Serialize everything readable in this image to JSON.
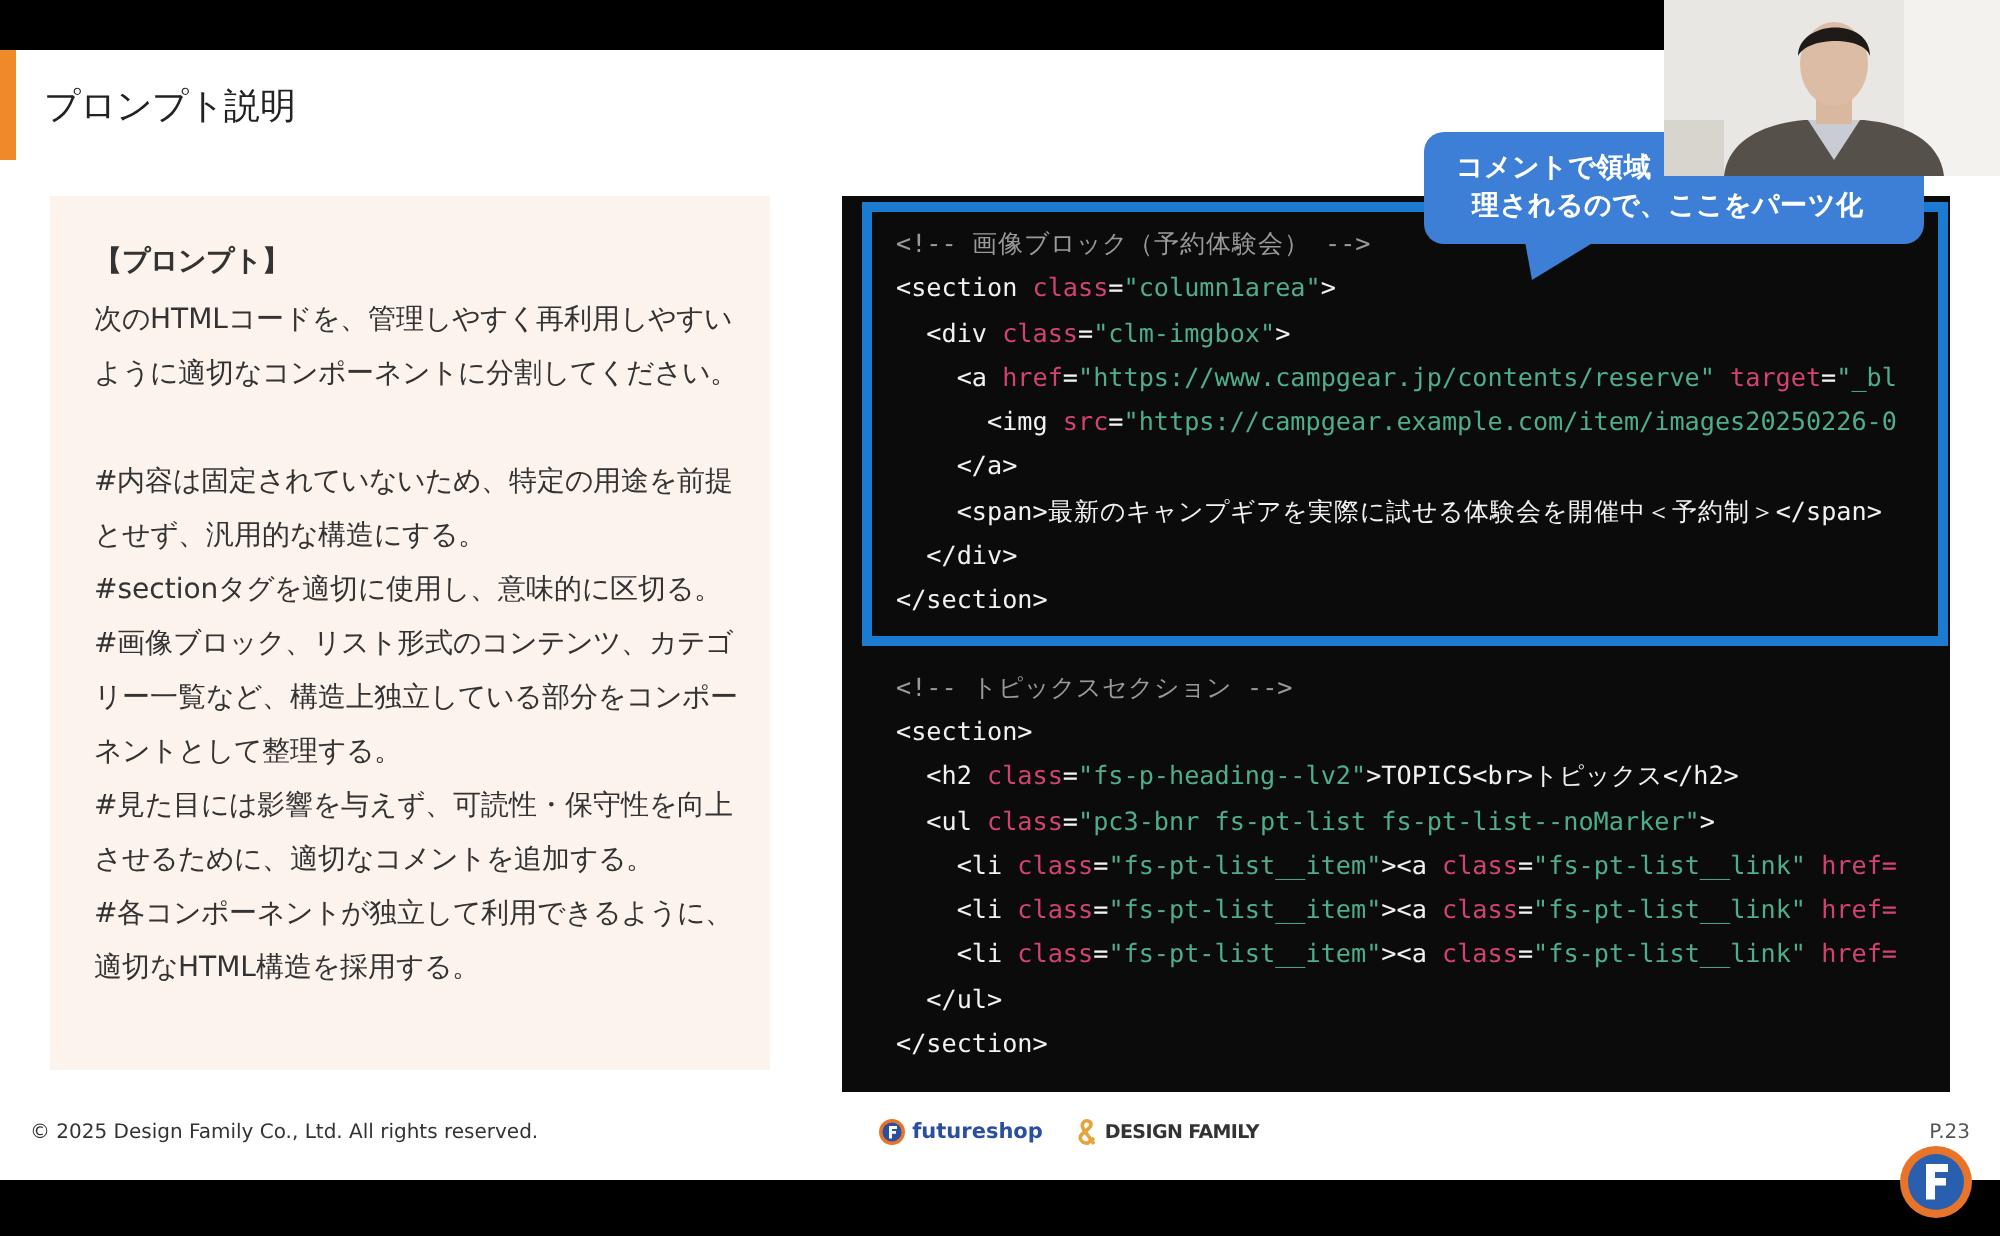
{
  "slide": {
    "title": "プロンプト説明",
    "prompt_box": {
      "heading": "【プロンプト】",
      "sections": [
        [
          "次のHTMLコードを、管理しやすく再利用しやすいように適切なコンポーネントに分割してください。"
        ],
        [
          "#内容は固定されていないため、特定の用途を前提とせず、汎用的な構造にする。",
          "#sectionタグを適切に使用し、意味的に区切る。",
          "#画像ブロック、リスト形式のコンテンツ、カテゴリー一覧など、構造上独立している部分をコンポーネントとして整理する。",
          "#見た目には影響を与えず、可読性・保守性を向上させるために、適切なコメントを追加する。",
          "#各コンポーネントが独立して利用できるように、適切なHTML構造を採用する。"
        ]
      ]
    },
    "code_blocks": [
      {
        "highlighted": true,
        "lines": [
          [
            {
              "kind": "comment",
              "text": "<!-- 画像ブロック（予約体験会） -->"
            }
          ],
          [
            {
              "kind": "tag",
              "text": "<section "
            },
            {
              "kind": "attr",
              "text": "class"
            },
            {
              "kind": "tag",
              "text": "="
            },
            {
              "kind": "str",
              "text": "\"column1area\""
            },
            {
              "kind": "tag",
              "text": ">"
            }
          ],
          [
            {
              "kind": "tag",
              "text": "  <div "
            },
            {
              "kind": "attr",
              "text": "class"
            },
            {
              "kind": "tag",
              "text": "="
            },
            {
              "kind": "str",
              "text": "\"clm-imgbox\""
            },
            {
              "kind": "tag",
              "text": ">"
            }
          ],
          [
            {
              "kind": "tag",
              "text": "    <a "
            },
            {
              "kind": "attr",
              "text": "href"
            },
            {
              "kind": "tag",
              "text": "="
            },
            {
              "kind": "str",
              "text": "\"https://www.campgear.jp/contents/reserve\""
            },
            {
              "kind": "attr",
              "text": " target"
            },
            {
              "kind": "tag",
              "text": "="
            },
            {
              "kind": "str",
              "text": "\"_bl"
            }
          ],
          [
            {
              "kind": "tag",
              "text": "      <img "
            },
            {
              "kind": "attr",
              "text": "src"
            },
            {
              "kind": "tag",
              "text": "="
            },
            {
              "kind": "str",
              "text": "\"https://campgear.example.com/item/images20250226-0"
            }
          ],
          [
            {
              "kind": "tag",
              "text": "    </a>"
            }
          ],
          [
            {
              "kind": "tag",
              "text": "    <span>最新のキャンプギアを実際に試せる体験会を開催中＜予約制＞</span>"
            }
          ],
          [
            {
              "kind": "tag",
              "text": "  </div>"
            }
          ],
          [
            {
              "kind": "tag",
              "text": "</section>"
            }
          ]
        ]
      },
      {
        "highlighted": false,
        "lines": [
          [
            {
              "kind": "comment",
              "text": "<!-- トピックスセクション -->"
            }
          ],
          [
            {
              "kind": "tag",
              "text": "<section>"
            }
          ],
          [
            {
              "kind": "tag",
              "text": "  <h2 "
            },
            {
              "kind": "attr",
              "text": "class"
            },
            {
              "kind": "tag",
              "text": "="
            },
            {
              "kind": "str",
              "text": "\"fs-p-heading--lv2\""
            },
            {
              "kind": "tag",
              "text": ">TOPICS<br>トピックス</h2>"
            }
          ],
          [
            {
              "kind": "tag",
              "text": "  <ul "
            },
            {
              "kind": "attr",
              "text": "class"
            },
            {
              "kind": "tag",
              "text": "="
            },
            {
              "kind": "str",
              "text": "\"pc3-bnr fs-pt-list fs-pt-list--noMarker\""
            },
            {
              "kind": "tag",
              "text": ">"
            }
          ],
          [
            {
              "kind": "tag",
              "text": "    <li "
            },
            {
              "kind": "attr",
              "text": "class"
            },
            {
              "kind": "tag",
              "text": "="
            },
            {
              "kind": "str",
              "text": "\"fs-pt-list__item\""
            },
            {
              "kind": "tag",
              "text": "><a "
            },
            {
              "kind": "attr",
              "text": "class"
            },
            {
              "kind": "tag",
              "text": "="
            },
            {
              "kind": "str",
              "text": "\"fs-pt-list__link\""
            },
            {
              "kind": "attr",
              "text": " href="
            }
          ],
          [
            {
              "kind": "tag",
              "text": "    <li "
            },
            {
              "kind": "attr",
              "text": "class"
            },
            {
              "kind": "tag",
              "text": "="
            },
            {
              "kind": "str",
              "text": "\"fs-pt-list__item\""
            },
            {
              "kind": "tag",
              "text": "><a "
            },
            {
              "kind": "attr",
              "text": "class"
            },
            {
              "kind": "tag",
              "text": "="
            },
            {
              "kind": "str",
              "text": "\"fs-pt-list__link\""
            },
            {
              "kind": "attr",
              "text": " href="
            }
          ],
          [
            {
              "kind": "tag",
              "text": "    <li "
            },
            {
              "kind": "attr",
              "text": "class"
            },
            {
              "kind": "tag",
              "text": "="
            },
            {
              "kind": "str",
              "text": "\"fs-pt-list__item\""
            },
            {
              "kind": "tag",
              "text": "><a "
            },
            {
              "kind": "attr",
              "text": "class"
            },
            {
              "kind": "tag",
              "text": "="
            },
            {
              "kind": "str",
              "text": "\"fs-pt-list__link\""
            },
            {
              "kind": "attr",
              "text": " href="
            }
          ],
          [
            {
              "kind": "tag",
              "text": "  </ul>"
            }
          ],
          [
            {
              "kind": "tag",
              "text": "</section>"
            }
          ]
        ]
      }
    ],
    "callout": {
      "lines": [
        "コメントで領域",
        "理されるので、ここをパーツ化"
      ]
    },
    "footer": {
      "copyright": "© 2025 Design Family Co., Ltd. All rights reserved.",
      "logo_1": "futureshop",
      "logo_2": "DESIGN FAMILY",
      "page": "P.23"
    }
  }
}
